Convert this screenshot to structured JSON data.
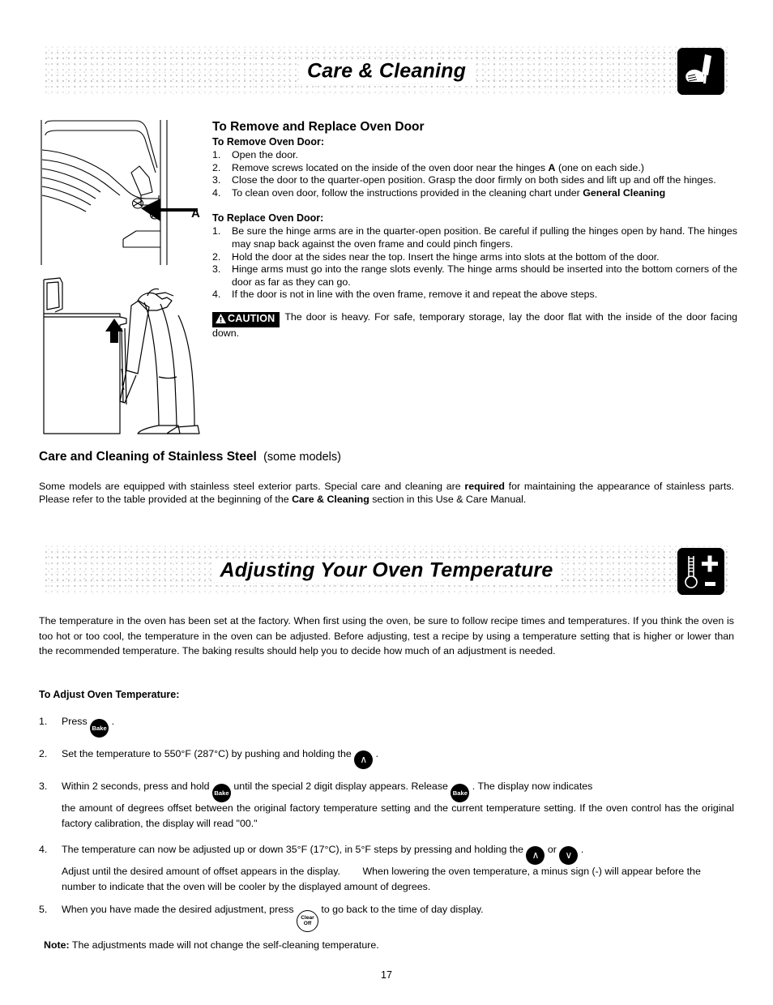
{
  "document": {
    "page_number": "17"
  },
  "banner1": {
    "title": "Care & Cleaning",
    "icon": "hand-cleaning-icon"
  },
  "banner2": {
    "title": "Adjusting Your Oven Temperature",
    "icon": "thermometer-plus-minus-icon"
  },
  "oven_door": {
    "heading": "To Remove and Replace Oven Door",
    "remove_subheading": "To Remove Oven Door:",
    "remove_steps": [
      {
        "num": "1.",
        "text": "Open the door."
      },
      {
        "num": "2.",
        "text_a": "Remove screws located on the inside of the oven door near the hinges ",
        "bold": "A",
        "text_b": " (one on each side.)"
      },
      {
        "num": "3.",
        "text": "Close the door to the quarter-open position. Grasp the door firmly on both sides and lift up and off the hinges."
      },
      {
        "num": "4.",
        "text_a": "To clean oven door, follow the instructions provided in the cleaning chart under ",
        "bold": "General Cleaning",
        "text_b": ""
      }
    ],
    "replace_subheading": "To Replace Oven Door:",
    "replace_steps": [
      {
        "num": "1.",
        "text": "Be sure the hinge arms are in the quarter-open position. Be careful if pulling the hinges open by hand. The hinges may snap back against the oven frame and could pinch fingers."
      },
      {
        "num": "2.",
        "text": "Hold the door at the sides near the top. Insert the hinge arms into slots at the bottom of the door."
      },
      {
        "num": "3.",
        "text": "Hinge arms must go into the range slots evenly. The hinge arms should be inserted into the bottom corners of the door as far as they can go."
      },
      {
        "num": "4.",
        "text": "If the door is not in line with the oven frame, remove it and repeat the above steps."
      }
    ],
    "caution_label": "CAUTION",
    "caution_text": "The door is heavy. For safe, temporary storage, lay the door flat with the inside of the door facing down.",
    "callout_label": "A"
  },
  "stainless": {
    "heading_bold": "Care and Cleaning of Stainless Steel",
    "heading_light": "(some models)",
    "body_a": "Some models are equipped with stainless steel exterior parts. Special care and cleaning are ",
    "body_bold1": "required",
    "body_b": " for maintaining the appearance of stainless parts. Please refer to the table provided at the beginning of the ",
    "body_bold2": "Care & Cleaning",
    "body_c": " section in this Use & Care Manual."
  },
  "temperature": {
    "intro": "The temperature in the oven has been set at the factory. When first using the oven, be sure to follow recipe times and temperatures. If you think the oven is too hot or too cool, the temperature in the oven can be adjusted. Before adjusting, test a recipe by using a temperature setting that is higher or lower than the recommended temperature. The baking results should help you to decide how much of an adjustment is needed.",
    "subheading": "To Adjust Oven Temperature:",
    "steps": {
      "s1": {
        "num": "1.",
        "a": "Press ",
        "key": "Bake",
        "b": " ."
      },
      "s2": {
        "num": "2.",
        "a": "Set the temperature to 550°F (287°C) by pushing and holding the ",
        "key": "∧",
        "b": " ."
      },
      "s3": {
        "num": "3.",
        "a": "Within 2 seconds, press and hold ",
        "key1": "Bake",
        "b": " until the special 2 digit display appears. Release ",
        "key2": "Bake",
        "c": " . The display now indicates",
        "cont": "the amount of degrees offset between the original factory temperature setting and the current temperature setting. If the oven control has the original factory calibration, the display will read \"00.\""
      },
      "s4": {
        "num": "4.",
        "a": "The temperature can now be adjusted up or down 35°F (17°C), in 5°F steps by pressing and holding the ",
        "key_up": "∧",
        "b": " or ",
        "key_down": "∨",
        "c": " .",
        "cont": "Adjust until the desired amount of offset appears in the display.        When lowering the oven temperature, a minus sign (-) will appear before the number to indicate that the oven will be cooler by the displayed amount of degrees."
      },
      "s5": {
        "num": "5.",
        "a": "When you have made the desired adjustment, press ",
        "key_line1": "Clear",
        "key_line2": "Off",
        "b": " to go back to the time of day display."
      }
    },
    "note_label": "Note:",
    "note_text": " The adjustments made will not change the self-cleaning temperature."
  }
}
